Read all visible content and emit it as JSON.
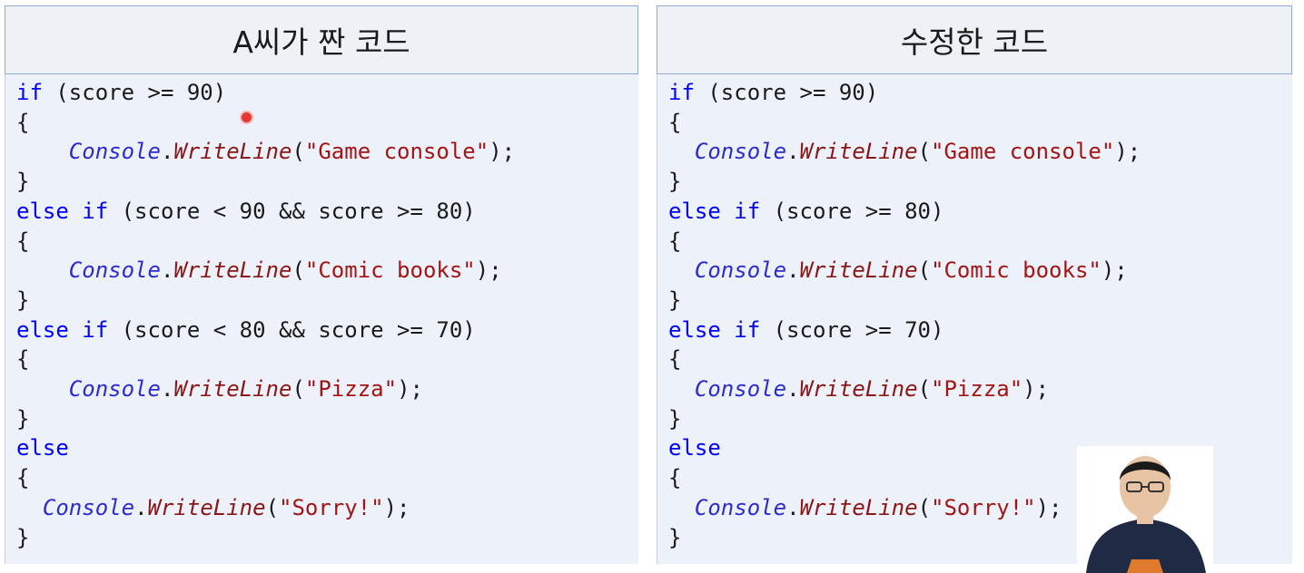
{
  "left_panel": {
    "title": "A씨가 짠 코드",
    "lines": [
      {
        "indent": "",
        "parts": [
          {
            "t": "if",
            "c": "kw"
          },
          {
            "t": " (score >= 90)",
            "c": "txt"
          }
        ]
      },
      {
        "indent": "",
        "parts": [
          {
            "t": "{",
            "c": "txt"
          }
        ]
      },
      {
        "indent": "    ",
        "parts": [
          {
            "t": "Console",
            "c": "cls"
          },
          {
            "t": ".",
            "c": "txt"
          },
          {
            "t": "WriteLine",
            "c": "mth"
          },
          {
            "t": "(",
            "c": "txt"
          },
          {
            "t": "\"Game console\"",
            "c": "str"
          },
          {
            "t": ");",
            "c": "txt"
          }
        ]
      },
      {
        "indent": "",
        "parts": [
          {
            "t": "}",
            "c": "txt"
          }
        ]
      },
      {
        "indent": "",
        "parts": [
          {
            "t": "else if",
            "c": "kw"
          },
          {
            "t": " (score < 90 && ",
            "c": "txt"
          },
          {
            "t": "score",
            "c": "txt"
          },
          {
            "t": " >= 80)",
            "c": "txt"
          }
        ]
      },
      {
        "indent": "",
        "parts": [
          {
            "t": "{",
            "c": "txt"
          }
        ]
      },
      {
        "indent": "    ",
        "parts": [
          {
            "t": "Console",
            "c": "cls"
          },
          {
            "t": ".",
            "c": "txt"
          },
          {
            "t": "WriteLine",
            "c": "mth"
          },
          {
            "t": "(",
            "c": "txt"
          },
          {
            "t": "\"Comic books\"",
            "c": "str"
          },
          {
            "t": ");",
            "c": "txt"
          }
        ]
      },
      {
        "indent": "",
        "parts": [
          {
            "t": "}",
            "c": "txt"
          }
        ]
      },
      {
        "indent": "",
        "parts": [
          {
            "t": "else if",
            "c": "kw"
          },
          {
            "t": " (score < 80 && ",
            "c": "txt"
          },
          {
            "t": "score",
            "c": "txt"
          },
          {
            "t": " >= 70)",
            "c": "txt"
          }
        ]
      },
      {
        "indent": "",
        "parts": [
          {
            "t": "{",
            "c": "txt"
          }
        ]
      },
      {
        "indent": "    ",
        "parts": [
          {
            "t": "Console",
            "c": "cls"
          },
          {
            "t": ".",
            "c": "txt"
          },
          {
            "t": "WriteLine",
            "c": "mth"
          },
          {
            "t": "(",
            "c": "txt"
          },
          {
            "t": "\"Pizza\"",
            "c": "str"
          },
          {
            "t": ");",
            "c": "txt"
          }
        ]
      },
      {
        "indent": "",
        "parts": [
          {
            "t": "}",
            "c": "txt"
          }
        ]
      },
      {
        "indent": "",
        "parts": [
          {
            "t": "else",
            "c": "kw"
          }
        ]
      },
      {
        "indent": "",
        "parts": [
          {
            "t": "{",
            "c": "txt"
          }
        ]
      },
      {
        "indent": "  ",
        "parts": [
          {
            "t": "Console",
            "c": "cls"
          },
          {
            "t": ".",
            "c": "txt"
          },
          {
            "t": "WriteLine",
            "c": "mth"
          },
          {
            "t": "(",
            "c": "txt"
          },
          {
            "t": "\"Sorry!\"",
            "c": "str"
          },
          {
            "t": ");",
            "c": "txt"
          }
        ]
      },
      {
        "indent": "",
        "parts": [
          {
            "t": "}",
            "c": "txt"
          }
        ]
      }
    ]
  },
  "right_panel": {
    "title": "수정한 코드",
    "lines": [
      {
        "indent": "",
        "parts": [
          {
            "t": "if",
            "c": "kw"
          },
          {
            "t": " (score >= 90)",
            "c": "txt"
          }
        ]
      },
      {
        "indent": "",
        "parts": [
          {
            "t": "{",
            "c": "txt"
          }
        ]
      },
      {
        "indent": "  ",
        "parts": [
          {
            "t": "Console",
            "c": "cls"
          },
          {
            "t": ".",
            "c": "txt"
          },
          {
            "t": "WriteLine",
            "c": "mth"
          },
          {
            "t": "(",
            "c": "txt"
          },
          {
            "t": "\"Game console\"",
            "c": "str"
          },
          {
            "t": ");",
            "c": "txt"
          }
        ]
      },
      {
        "indent": "",
        "parts": [
          {
            "t": "}",
            "c": "txt"
          }
        ]
      },
      {
        "indent": "",
        "parts": [
          {
            "t": "else if",
            "c": "kw"
          },
          {
            "t": " (score >= 80)",
            "c": "txt"
          }
        ]
      },
      {
        "indent": "",
        "parts": [
          {
            "t": "{",
            "c": "txt"
          }
        ]
      },
      {
        "indent": "  ",
        "parts": [
          {
            "t": "Console",
            "c": "cls"
          },
          {
            "t": ".",
            "c": "txt"
          },
          {
            "t": "WriteLine",
            "c": "mth"
          },
          {
            "t": "(",
            "c": "txt"
          },
          {
            "t": "\"Comic books\"",
            "c": "str"
          },
          {
            "t": ");",
            "c": "txt"
          }
        ]
      },
      {
        "indent": "",
        "parts": [
          {
            "t": "}",
            "c": "txt"
          }
        ]
      },
      {
        "indent": "",
        "parts": [
          {
            "t": "else if",
            "c": "kw"
          },
          {
            "t": " (score >= 70)",
            "c": "txt"
          }
        ]
      },
      {
        "indent": "",
        "parts": [
          {
            "t": "{",
            "c": "txt"
          }
        ]
      },
      {
        "indent": "  ",
        "parts": [
          {
            "t": "Console",
            "c": "cls"
          },
          {
            "t": ".",
            "c": "txt"
          },
          {
            "t": "WriteLine",
            "c": "mth"
          },
          {
            "t": "(",
            "c": "txt"
          },
          {
            "t": "\"Pizza\"",
            "c": "str"
          },
          {
            "t": ");",
            "c": "txt"
          }
        ]
      },
      {
        "indent": "",
        "parts": [
          {
            "t": "}",
            "c": "txt"
          }
        ]
      },
      {
        "indent": "",
        "parts": [
          {
            "t": "else",
            "c": "kw"
          }
        ]
      },
      {
        "indent": "",
        "parts": [
          {
            "t": "{",
            "c": "txt"
          }
        ]
      },
      {
        "indent": "  ",
        "parts": [
          {
            "t": "Console",
            "c": "cls"
          },
          {
            "t": ".",
            "c": "txt"
          },
          {
            "t": "WriteLine",
            "c": "mth"
          },
          {
            "t": "(",
            "c": "txt"
          },
          {
            "t": "\"Sorry!\"",
            "c": "str"
          },
          {
            "t": ");",
            "c": "txt"
          }
        ]
      },
      {
        "indent": "",
        "parts": [
          {
            "t": "}",
            "c": "txt"
          }
        ]
      }
    ]
  },
  "colors": {
    "keyword": "#0000ff",
    "class": "#2b2bd0",
    "method": "#8a1616",
    "string": "#a31515",
    "header_bg": "#eef1f5",
    "code_bg": "#edf1fa",
    "border": "#8faad3"
  },
  "icons": {
    "cursor": "laser-pointer-dot",
    "presenter": "presenter-webcam"
  }
}
